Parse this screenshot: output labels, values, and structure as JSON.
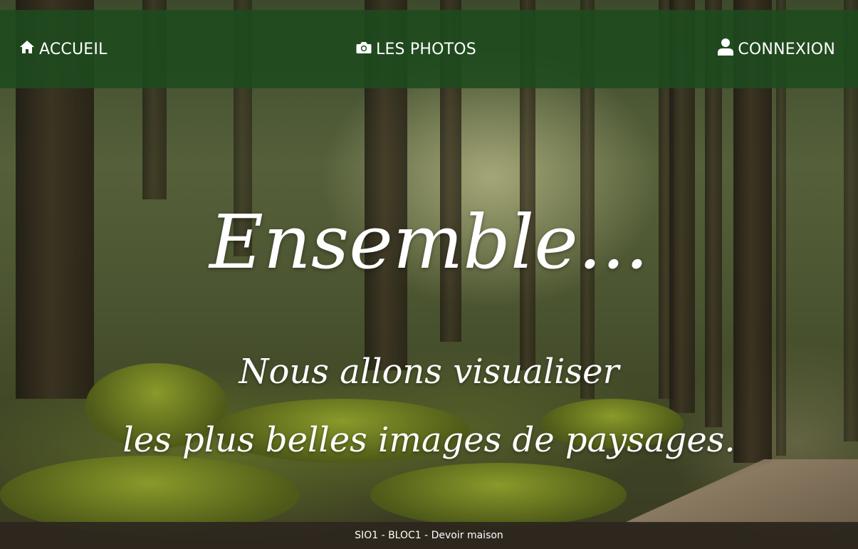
{
  "nav": {
    "home": {
      "label": "ACCUEIL",
      "icon": "home-icon"
    },
    "photos": {
      "label": "LES PHOTOS",
      "icon": "camera-icon"
    },
    "login": {
      "label": "CONNEXION",
      "icon": "user-icon"
    }
  },
  "hero": {
    "title": "Ensemble...",
    "line1": "Nous allons visualiser",
    "line2": "les plus belles images de paysages."
  },
  "footer": {
    "text": "SIO1 - BLOC1 - Devoir maison"
  },
  "colors": {
    "navbar": "#1e4b1e",
    "footer": "#2d261e",
    "text": "#ffffff"
  }
}
